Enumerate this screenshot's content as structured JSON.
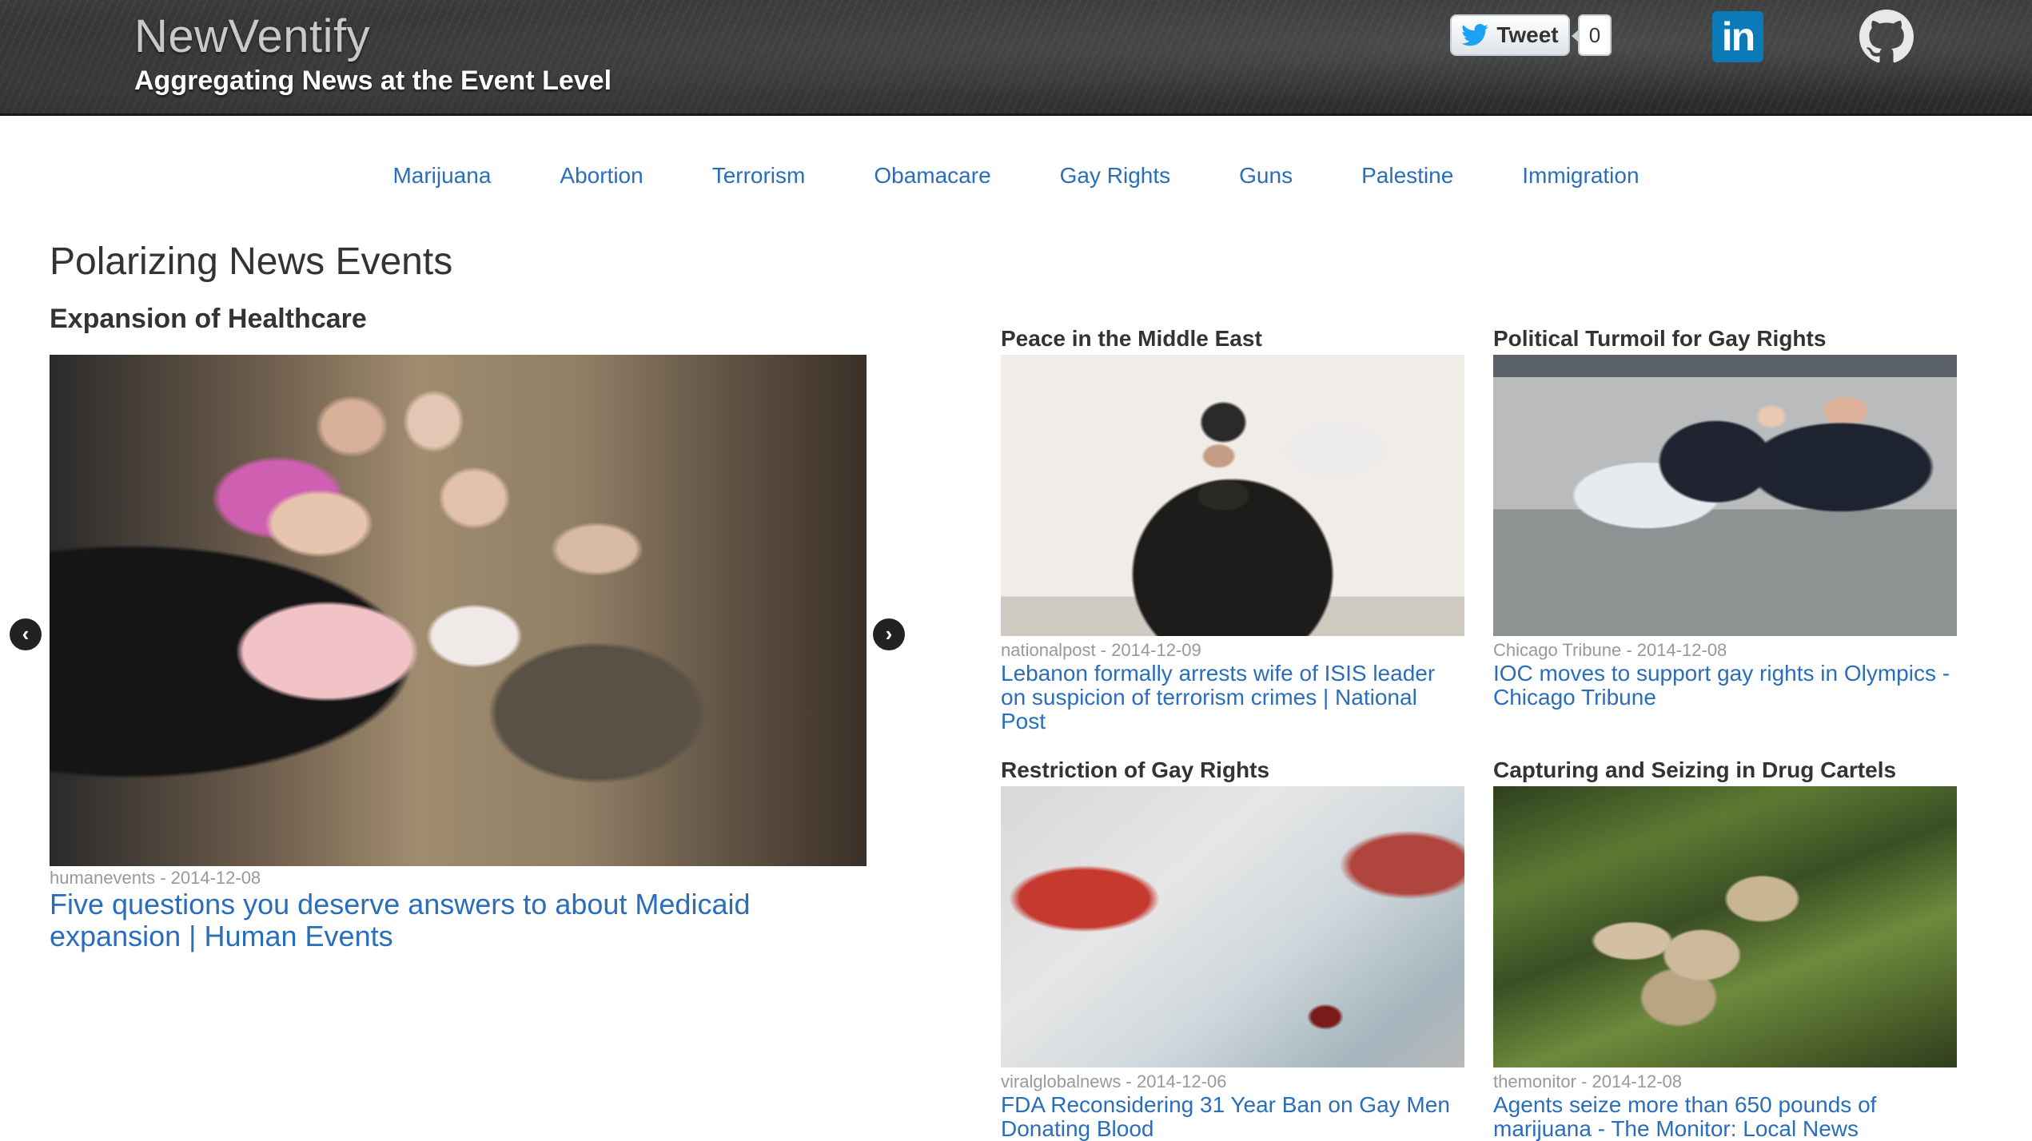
{
  "header": {
    "brand": "NewVentify",
    "tagline": "Aggregating News at the Event Level",
    "tweet_label": "Tweet",
    "tweet_count": "0",
    "linkedin_label": "in"
  },
  "nav": {
    "items": [
      {
        "label": "Marijuana"
      },
      {
        "label": "Abortion"
      },
      {
        "label": "Terrorism"
      },
      {
        "label": "Obamacare"
      },
      {
        "label": "Gay Rights"
      },
      {
        "label": "Guns"
      },
      {
        "label": "Palestine"
      },
      {
        "label": "Immigration"
      }
    ]
  },
  "main": {
    "title": "Polarizing News Events",
    "hero": {
      "heading": "Expansion of Healthcare",
      "source": "humanevents",
      "date": "2014-12-08",
      "meta": "humanevents - 2014-12-08",
      "headline": "Five questions you deserve answers to about Medicaid expansion | Human Events"
    },
    "cards": [
      {
        "heading": "Peace in the Middle East",
        "meta": "nationalpost - 2014-12-09",
        "headline": "Lebanon formally arrests wife of ISIS leader on suspicion of terrorism crimes | National Post"
      },
      {
        "heading": "Political Turmoil for Gay Rights",
        "meta": "Chicago Tribune - 2014-12-08",
        "headline": "IOC moves to support gay rights in Olympics - Chicago Tribune"
      },
      {
        "heading": "Restriction of Gay Rights",
        "meta": "viralglobalnews - 2014-12-06",
        "headline": "FDA Reconsidering 31 Year Ban on Gay Men Donating Blood"
      },
      {
        "heading": "Capturing and Seizing in Drug Cartels",
        "meta": "themonitor - 2014-12-08",
        "headline": "Agents seize more than 650 pounds of marijuana - The Monitor: Local News"
      }
    ]
  },
  "icons": {
    "twitter": "twitter-bird-icon",
    "linkedin": "linkedin-icon",
    "github": "github-icon",
    "prev": "chevron-left-icon",
    "next": "chevron-right-icon"
  },
  "colors": {
    "link": "#2a6ebb",
    "header_bg": "#2e2e2e",
    "linkedin": "#0a7bb8",
    "twitter": "#1da1f2"
  }
}
